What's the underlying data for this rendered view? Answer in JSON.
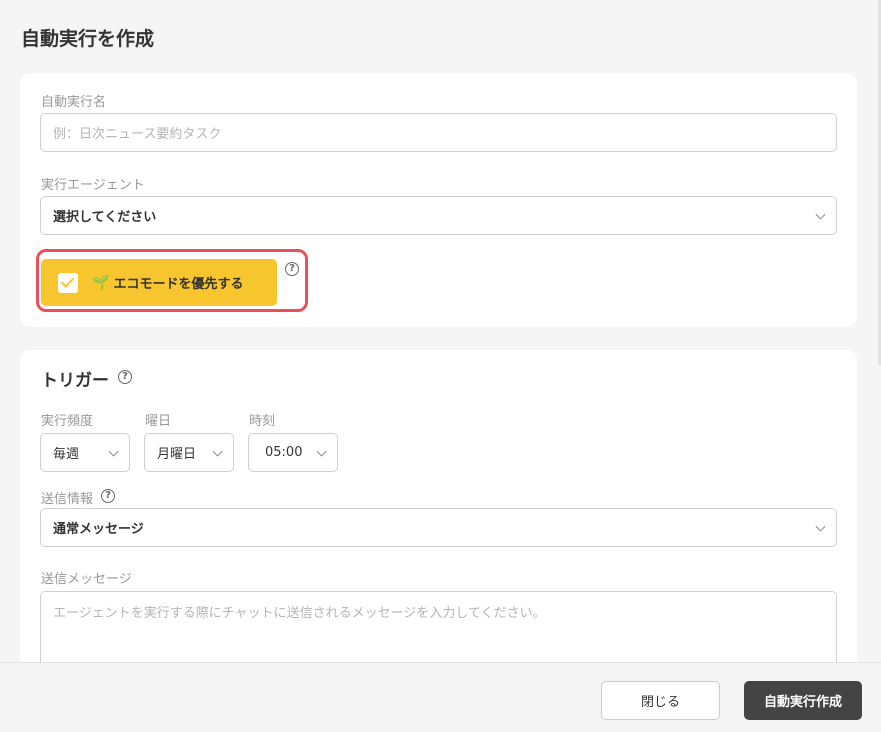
{
  "dialog": {
    "title": "自動実行を作成"
  },
  "basic": {
    "name_label": "自動実行名",
    "name_placeholder": "例：日次ニュース要約タスク",
    "agent_label": "実行エージェント",
    "agent_value": "選択してください",
    "eco_label": "エコモードを優先する",
    "eco_checked": true,
    "eco_icon": "sprout-icon"
  },
  "trigger": {
    "title": "トリガー",
    "frequency_label": "実行頻度",
    "frequency_value": "毎週",
    "weekday_label": "曜日",
    "weekday_value": "月曜日",
    "time_label": "時刻",
    "time_value": "05:00",
    "send_info_label": "送信情報",
    "send_info_value": "通常メッセージ",
    "message_label": "送信メッセージ",
    "message_placeholder": "エージェントを実行する際にチャットに送信されるメッセージを入力してください。"
  },
  "footer": {
    "close_label": "閉じる",
    "create_label": "自動実行作成"
  },
  "colors": {
    "accent": "#f7c52d",
    "highlight": "#e8505b",
    "primary_button": "#444444"
  }
}
